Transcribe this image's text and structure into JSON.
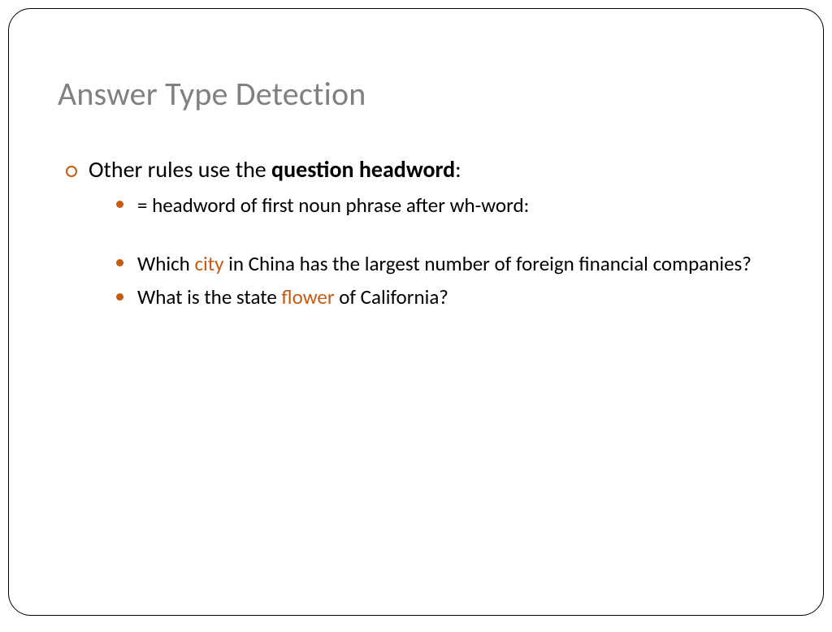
{
  "title": "Answer Type Detection",
  "bullet1_pre": "Other rules use the ",
  "bullet1_bold": "question headword",
  "bullet1_post": ":",
  "sub1": "= headword of first noun phrase after wh-word:",
  "sub2_pre": "Which ",
  "sub2_hl": "city",
  "sub2_post": " in China has the largest number of foreign financial companies?",
  "sub3_pre": "What is the state ",
  "sub3_hl": "flower",
  "sub3_post": " of California?"
}
